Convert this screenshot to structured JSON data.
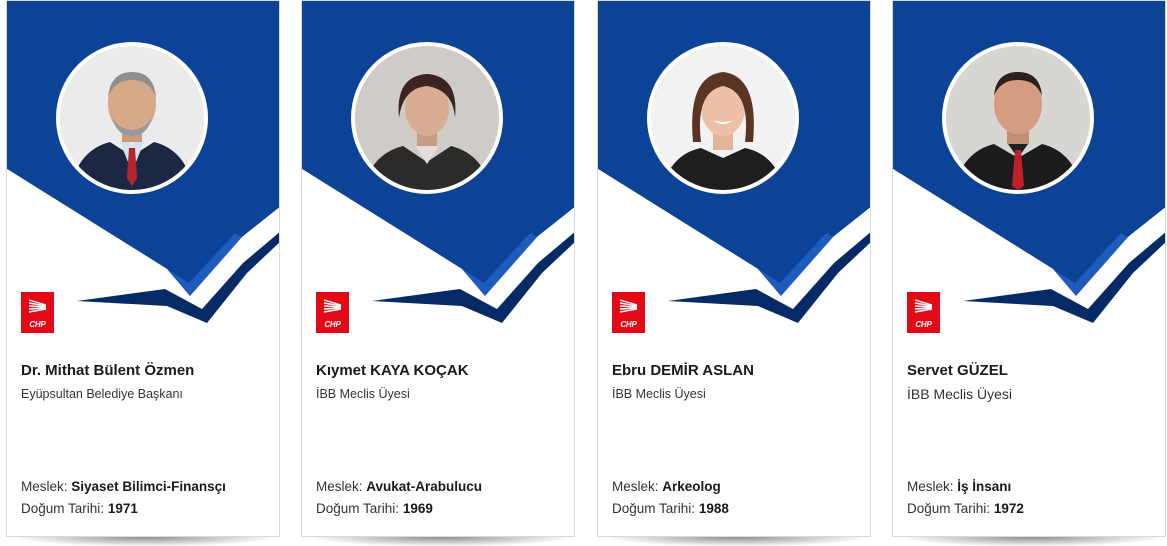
{
  "brand": {
    "ribbon_color": "#0c4397",
    "ribbon_dark": "#062a66",
    "accent_red": "#e30a17"
  },
  "labels": {
    "profession": "Meslek:",
    "birth_date": "Doğum Tarihi:"
  },
  "party": {
    "logo_text": "CHP",
    "logo_icon": "chp-six-arrows-logo"
  },
  "members": [
    {
      "name": "Dr. Mithat Bülent Özmen",
      "role": "Eyüpsultan Belediye Başkanı",
      "profession": "Siyaset Bilimci-Finansçı",
      "birth_year": "1971"
    },
    {
      "name": "Kıymet KAYA KOÇAK",
      "role": "İBB Meclis Üyesi",
      "profession": "Avukat-Arabulucu",
      "birth_year": "1969"
    },
    {
      "name": "Ebru DEMİR ASLAN",
      "role": "İBB Meclis Üyesi",
      "profession": "Arkeolog",
      "birth_year": "1988"
    },
    {
      "name": "Servet GÜZEL",
      "role": "İBB Meclis Üyesi",
      "profession": "İş İnsanı",
      "birth_year": "1972"
    }
  ]
}
